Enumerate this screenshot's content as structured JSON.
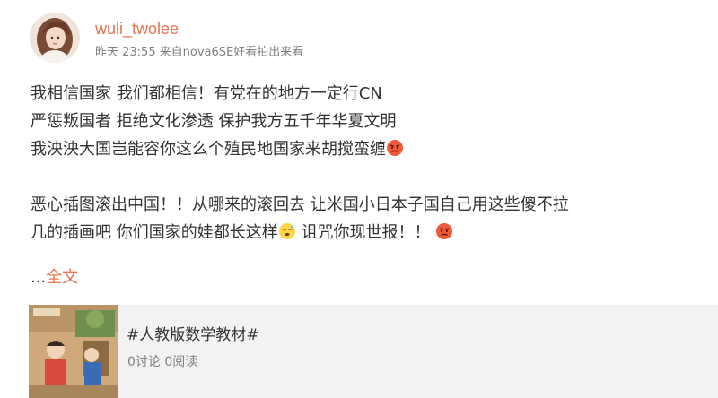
{
  "author": {
    "name": "wuli_twolee",
    "time": "昨天 23:55",
    "source_prefix": "来自",
    "source": "nova6SE好看拍出来看"
  },
  "content": {
    "lines": [
      "我相信国家 我们都相信！有党在的地方一定行CN",
      "严惩叛国者 拒绝文化渗透 保护我方五千年华夏文明",
      "我泱泱大国岂能容你这么个殖民地国家来胡搅蛮缠"
    ],
    "para2_line1": "恶心插图滚出中国！！从哪来的滚回去 让米国小日本子国自己用这些傻不拉",
    "para2_line2a": "几的插画吧 你们国家的娃都长这样",
    "para2_line2b": " 诅咒你现世报！！",
    "emoji_icons": [
      "angry-face-icon",
      "embarrassed-face-icon",
      "angry-face-icon"
    ]
  },
  "expand": {
    "ellipsis": "...",
    "label": "全文"
  },
  "topic_card": {
    "title": "#人教版数学教材#",
    "stats": "0讨论 0阅读"
  },
  "colors": {
    "accent": "#eb7350",
    "meta": "#808080",
    "card_bg": "#f2f2f5"
  }
}
